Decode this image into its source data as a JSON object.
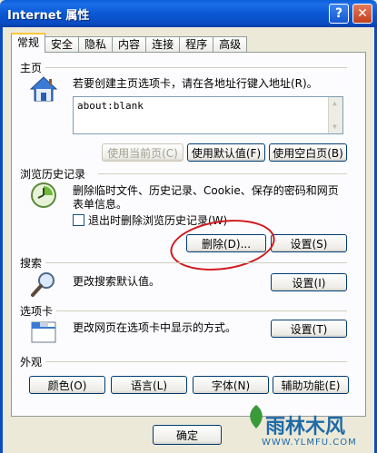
{
  "window": {
    "title": "Internet 属性",
    "help_glyph": "?",
    "close_glyph": "✕"
  },
  "tabs": [
    {
      "label": "常规",
      "active": true
    },
    {
      "label": "安全",
      "active": false
    },
    {
      "label": "隐私",
      "active": false
    },
    {
      "label": "内容",
      "active": false
    },
    {
      "label": "连接",
      "active": false
    },
    {
      "label": "程序",
      "active": false
    },
    {
      "label": "高级",
      "active": false
    }
  ],
  "homepage": {
    "group_title": "主页",
    "description": "若要创建主页选项卡，请在各地址行键入地址(R)。",
    "address_value": "about:blank",
    "buttons": {
      "use_current": "使用当前页(C)",
      "use_default": "使用默认值(F)",
      "use_blank": "使用空白页(B)"
    }
  },
  "history": {
    "group_title": "浏览历史记录",
    "description_line1": "删除临时文件、历史记录、Cookie、保存的密码和网页",
    "description_line2": "表单信息。",
    "checkbox_label": "退出时删除浏览历史记录(W)",
    "checkbox_checked": false,
    "delete_button": "删除(D)...",
    "settings_button": "设置(S)"
  },
  "search": {
    "group_title": "搜索",
    "description": "更改搜索默认值。",
    "settings_button": "设置(I)"
  },
  "tabs_group": {
    "group_title": "选项卡",
    "description": "更改网页在选项卡中显示的方式。",
    "settings_button": "设置(T)"
  },
  "appearance": {
    "group_title": "外观",
    "buttons": {
      "colors": "颜色(O)",
      "languages": "语言(L)",
      "fonts": "字体(N)",
      "accessibility": "辅助功能(E)"
    }
  },
  "footer": {
    "ok_button": "确定"
  },
  "watermark": {
    "name": "雨林木风",
    "url": "WWW.YLMFU.COM"
  },
  "colors": {
    "titlebar_blue": "#0a58d4",
    "annotation_red": "#d0181e"
  }
}
